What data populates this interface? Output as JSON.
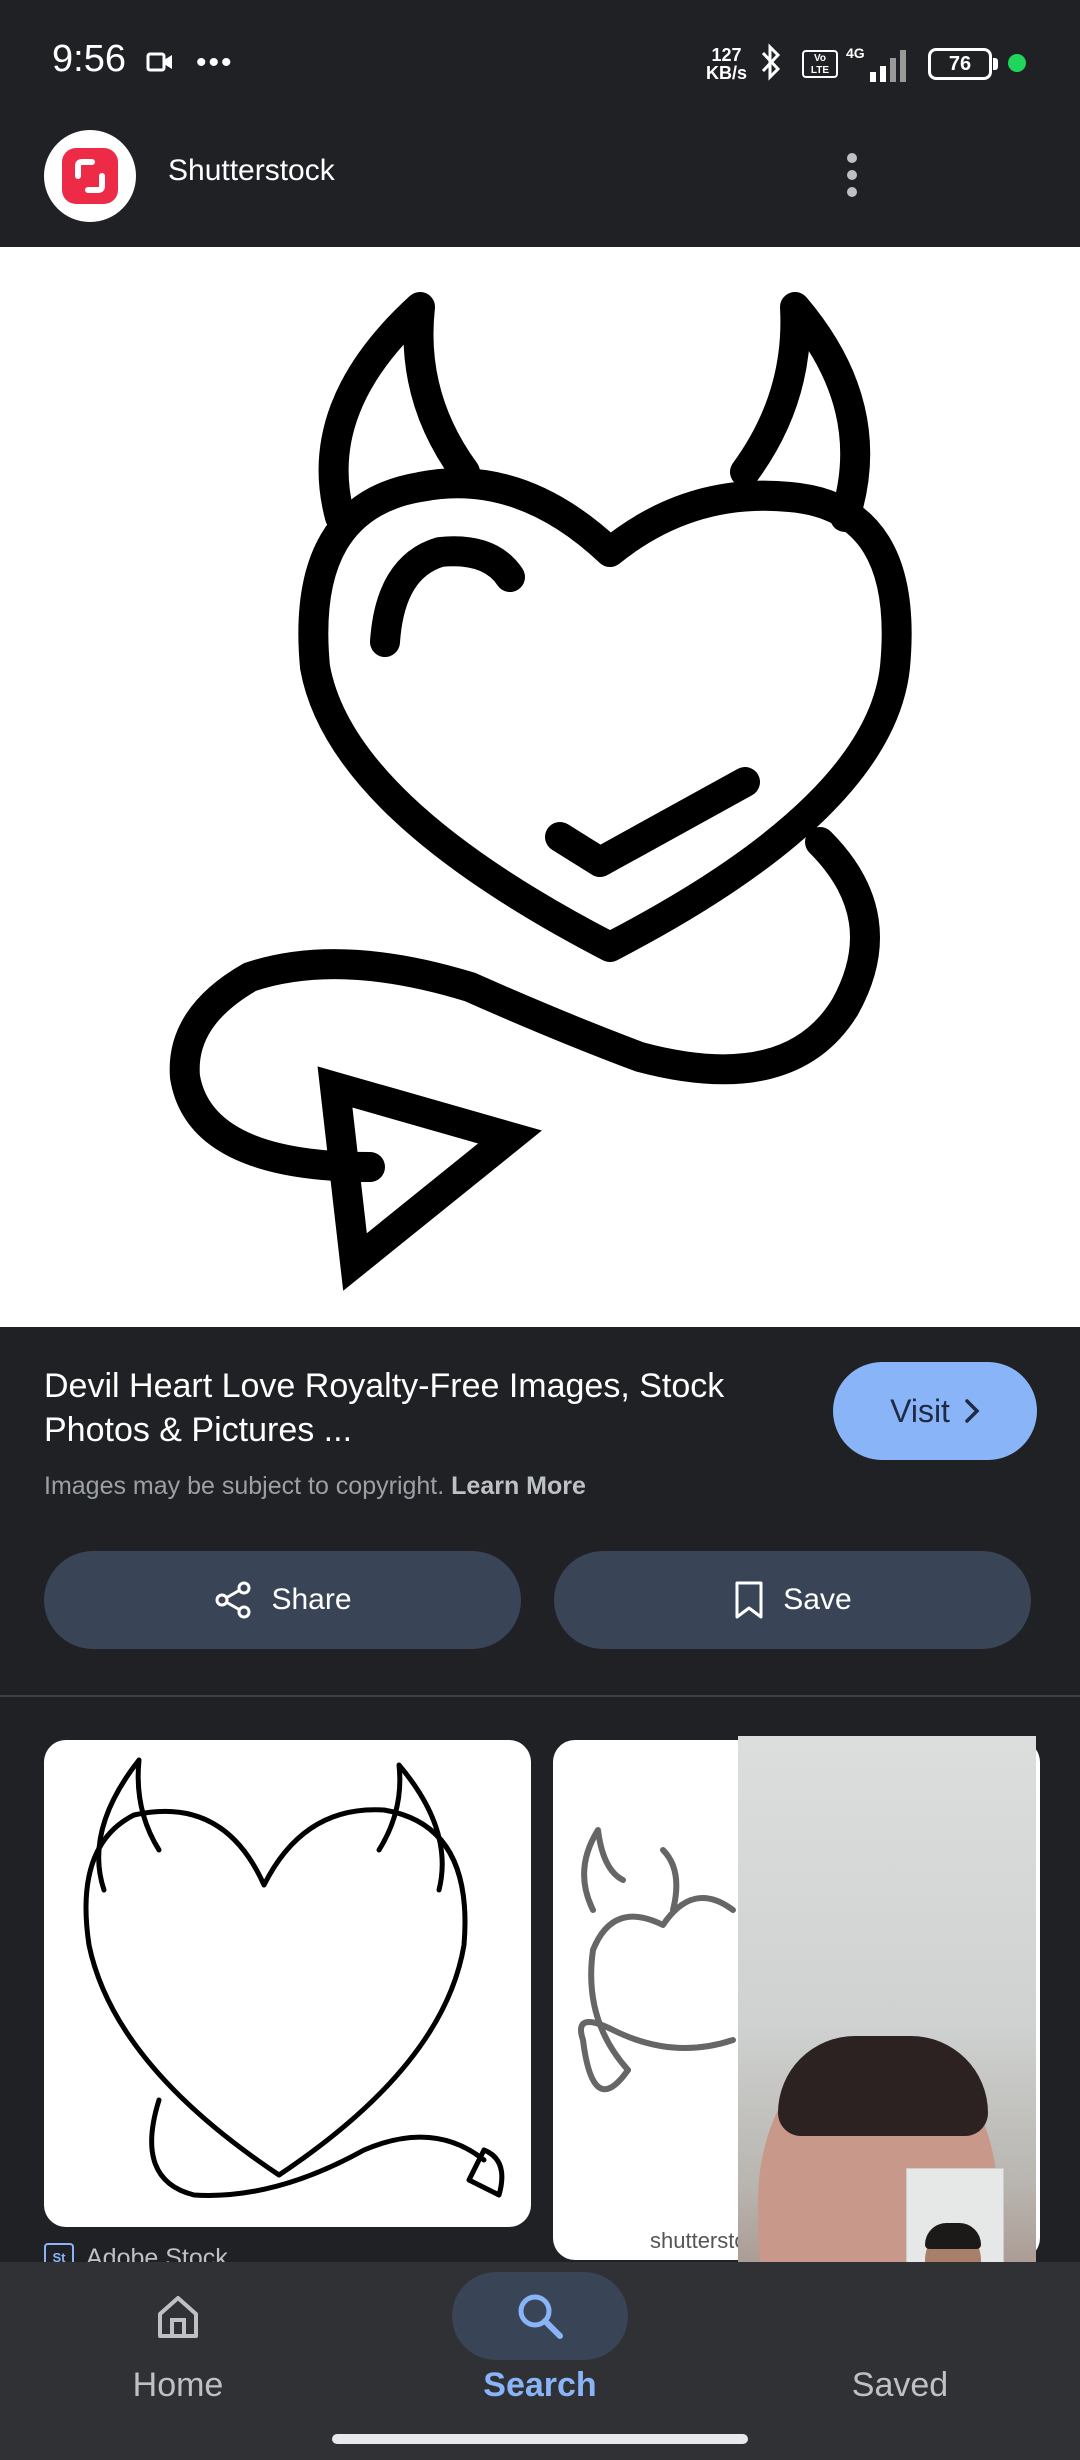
{
  "status_bar": {
    "time": "9:56",
    "network_speed_top": "127",
    "network_speed_bottom": "KB/s",
    "volte_label": "Vo LTE",
    "network_type": "4G",
    "battery": "76"
  },
  "header": {
    "source_name": "Shutterstock"
  },
  "result": {
    "title": "Devil Heart Love Royalty-Free Images, Stock Photos & Pictures ...",
    "copyright_text": "Images may be subject to copyright.",
    "learn_more": "Learn More",
    "visit_label": "Visit",
    "share_label": "Share",
    "save_label": "Save"
  },
  "related": {
    "card1_source": "Adobe Stock",
    "card1_badge": "St",
    "card2_watermark": "shutterstock"
  },
  "bottom_nav": {
    "items": [
      {
        "label": "Home",
        "icon": "home-icon",
        "active": false
      },
      {
        "label": "Search",
        "icon": "search-icon",
        "active": true
      },
      {
        "label": "Saved",
        "icon": "bookmark-icon",
        "active": false
      }
    ]
  },
  "colors": {
    "background": "#202124",
    "accent": "#8ab4f8",
    "button_bg": "#394457",
    "logo_red": "#ee2b47"
  }
}
